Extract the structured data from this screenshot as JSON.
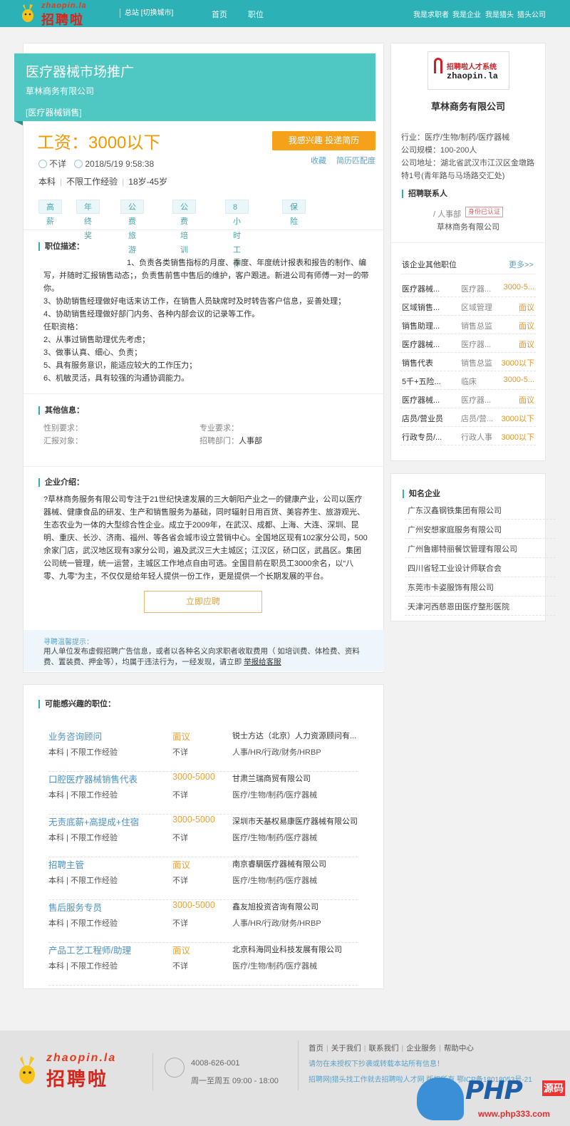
{
  "header": {
    "logo_url_text": "zhaopin.la",
    "logo_cn": "招聘啦",
    "city": "总站 [切换城市]",
    "nav": [
      "首页",
      "职位"
    ],
    "right_links": [
      "我是求职者",
      "我是企业",
      "我是猎头",
      "猎头公司"
    ]
  },
  "job": {
    "title": "医疗器械市场推广",
    "company": "草林商务有限公司",
    "category": "[医疗器械销售]",
    "salary": "工资：3000以下",
    "apply_button": "我感兴趣 投递简历",
    "location": "不详",
    "posted": "2018/5/19 9:58:38",
    "favorite": "收藏",
    "match": "简历匹配度",
    "education": "本科",
    "experience": "不限工作经验",
    "age": "18岁-45岁",
    "tags": [
      "高薪",
      "年终奖",
      "公费旅游",
      "公费培训",
      "8小时工作",
      "保险"
    ]
  },
  "description": {
    "heading": "职位描述：",
    "lines": [
      "1、负责各类销售指标的月度、季度、年度统计报表和报告的制作、编写，并随时汇报销售动态；，负责售前售中售后的维护，客户跟进。新进公司有师傅一对一的带你。",
      "3、协助销售经理做好电话来访工作，在销售人员缺席时及时转告客户信息，妥善处理；",
      "4、协助销售经理做好部门内务、各种内部会议的记录等工作。",
      "任职资格：",
      "2、从事过销售助理优先考虑；",
      "3、做事认真、细心、负责；",
      "5、具有服务意识，能适应较大的工作压力；",
      "6、机敏灵活，具有较强的沟通协调能力。"
    ]
  },
  "other_info": {
    "heading": "其他信息：",
    "gender_label": "性别要求：",
    "gender_value": "",
    "major_label": "专业要求：",
    "major_value": "",
    "report_label": "汇报对象：",
    "report_value": "",
    "dept_label": "招聘部门：",
    "dept_value": "人事部"
  },
  "intro": {
    "heading": "企业介绍：",
    "text": "?草林商务服务有限公司专注于21世纪快速发展的三大朝阳产业之一的健康产业，公司以医疗器械、健康食品的研发、生产和销售服务为基础，同时辐射日用百货、美容养生、旅游观光、生态农业为一体的大型综合性企业。成立于2009年，在武汉、成都、上海、大连、深圳、昆明、重庆、长沙、济南、福州、等各省会城市设立营销中心。全国地区现有102家分公司，500余家门店，武汉地区现有3家分公司，遍及武汉三大主城区；江汉区，硚口区，武昌区。集团公司统一管理，统一运营，主城区工作地点自由可选。全国目前在职员工3000余名，以“八零、九零”为主，不仅仅是给年轻人提供一份工作，更是提供一个长期发展的平台。",
    "apply_button": "立即应聘"
  },
  "tip": {
    "title": "寻聘温馨提示：",
    "body": "用人单位发布虚假招聘广告信息，或者以各种名义向求职者收取费用（ 如培训费、体检费、资料费、置装费、押金等），均属于违法行为，一经发现，请立即 ",
    "link": "举报给客服"
  },
  "related": {
    "heading": "可能感兴趣的职位：",
    "items": [
      {
        "title": "业务咨询顾问",
        "salary": "面议",
        "company": "锐士方达（北京）人力资源顾问有...",
        "edu": "本科 | 不限工作经验",
        "loc": "不详",
        "industry": "人事/HR/行政/财务/HRBP"
      },
      {
        "title": "口腔医疗器械销售代表",
        "salary": "3000-5000",
        "company": "甘肃兰瑞商贸有限公司",
        "edu": "本科 | 不限工作经验",
        "loc": "不详",
        "industry": "医疗/生物/制药/医疗器械"
      },
      {
        "title": "无责底薪+高提成+住宿",
        "salary": "3000-5000",
        "company": "深圳市天基权易康医疗器械有限公司",
        "edu": "本科 | 不限工作经验",
        "loc": "不详",
        "industry": "医疗/生物/制药/医疗器械"
      },
      {
        "title": "招聘主管",
        "salary": "面议",
        "company": "南京睿騆医疗器械有限公司",
        "edu": "本科 | 不限工作经验",
        "loc": "不详",
        "industry": "医疗/生物/制药/医疗器械"
      },
      {
        "title": "售后服务专员",
        "salary": "3000-5000",
        "company": "鑫友旭投资咨询有限公司",
        "edu": "本科 | 不限工作经验",
        "loc": "不详",
        "industry": "人事/HR/行政/财务/HRBP"
      },
      {
        "title": "产品工艺工程师/助理",
        "salary": "面议",
        "company": "北京科海同业科技发展有限公司",
        "edu": "本科 | 不限工作经验",
        "loc": "不详",
        "industry": "医疗/生物/制药/医疗器械"
      }
    ]
  },
  "sidebar": {
    "logo_text_1": "招聘啦人才系统",
    "logo_text_2": "zhaopin.la",
    "company_name": "草林商务有限公司",
    "industry": "行业：医疗/生物/制药/医疗器械",
    "scale": "公司规模：100-200人",
    "address": "公司地址：湖北省武汉市江汉区金墩路特1号(青年路与马场路交汇处)",
    "contact_heading": "招聘联系人",
    "contact_person": "/ 人事部",
    "verified": "身份已认证",
    "contact_company": "草林商务有限公司",
    "other_heading": "该企业其他职位",
    "more": "更多>>",
    "other_jobs": [
      {
        "title": "医疗器械...",
        "cat": "医疗器...",
        "salary": "3000-5..."
      },
      {
        "title": "区域销售...",
        "cat": "区域管理",
        "salary": "面议"
      },
      {
        "title": "销售助理...",
        "cat": "销售总监",
        "salary": "面议"
      },
      {
        "title": "医疗器械...",
        "cat": "医疗器...",
        "salary": "面议"
      },
      {
        "title": "销售代表",
        "cat": "销售总监",
        "salary": "3000以下"
      },
      {
        "title": "5千+五险...",
        "cat": "临床",
        "salary": "3000-5..."
      },
      {
        "title": "医疗器械...",
        "cat": "医疗器...",
        "salary": "面议"
      },
      {
        "title": "店员/营业员",
        "cat": "店员/营...",
        "salary": "3000以下"
      },
      {
        "title": "行政专员/...",
        "cat": "行政人事",
        "salary": "3000以下"
      }
    ],
    "famous_heading": "知名企业",
    "famous": [
      "广东汉鑫钢铁集团有限公司",
      "广州安想家庭服务有限公司",
      "广州鲁娜特丽餐饮管理有限公司",
      "四川省轻工业设计师联合会",
      "东莞市卡姿服饰有限公司",
      "天津河西慈恩田医疗整形医院"
    ]
  },
  "footer": {
    "phone": "4008-626-001",
    "hours": "周一至周五 09:00 - 18:00",
    "links": [
      "首页",
      "关于我们",
      "联系我们",
      "企业服务",
      "帮助中心"
    ],
    "line1": "请勿在未授权下抄袭或转载本站所有信息！",
    "line2": "招聘网|猎头找工作就去招聘啦人才网 版权所有 鄂ICP备18018053号-21"
  },
  "watermark": {
    "php": "PHP",
    "yuanma": "源码",
    "domain": "www.php333.com"
  },
  "colors": {
    "brand_teal": "#2bb1b6",
    "banner": "#4fc7c3",
    "salary_orange": "#f39800",
    "link_blue": "#4c92c3"
  }
}
